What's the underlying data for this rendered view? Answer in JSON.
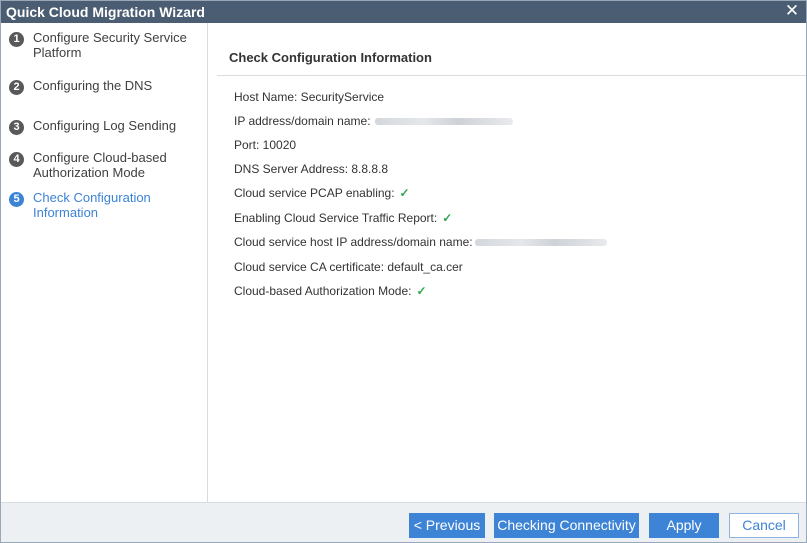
{
  "window": {
    "title": "Quick Cloud Migration Wizard",
    "close_glyph": "✕"
  },
  "steps": [
    {
      "number": "1",
      "label": "Configure Security Service Platform",
      "active": false
    },
    {
      "number": "2",
      "label": "Configuring the DNS",
      "active": false
    },
    {
      "number": "3",
      "label": "Configuring Log Sending",
      "active": false
    },
    {
      "number": "4",
      "label": "Configure Cloud-based Authorization Mode",
      "active": false
    },
    {
      "number": "5",
      "label": "Check Configuration Information",
      "active": true
    }
  ],
  "main": {
    "title": "Check Configuration Information",
    "rows": {
      "host_name": "Host Name: SecurityService",
      "ip_address": "IP address/domain name:",
      "port": "Port: 10020",
      "dns_server": "DNS Server Address: 8.8.8.8",
      "pcap_enabling": "Cloud service PCAP enabling:",
      "traffic_report": "Enabling Cloud Service Traffic Report:",
      "cloud_host_ip": "Cloud service host IP address/domain name:",
      "ca_certificate": "Cloud service CA certificate: default_ca.cer",
      "auth_mode": "Cloud-based Authorization Mode:"
    },
    "check_glyph": "✓"
  },
  "footer": {
    "previous_label": "< Previous",
    "check_connectivity_label": "Checking Connectivity",
    "apply_label": "Apply",
    "cancel_label": "Cancel"
  },
  "colors": {
    "titlebar": "#4b5d72",
    "accent": "#3d83d6",
    "check": "#2fa84f",
    "footer_bg": "#edf0f3"
  },
  "icons": {
    "close": "close-icon",
    "check": "check-icon"
  }
}
